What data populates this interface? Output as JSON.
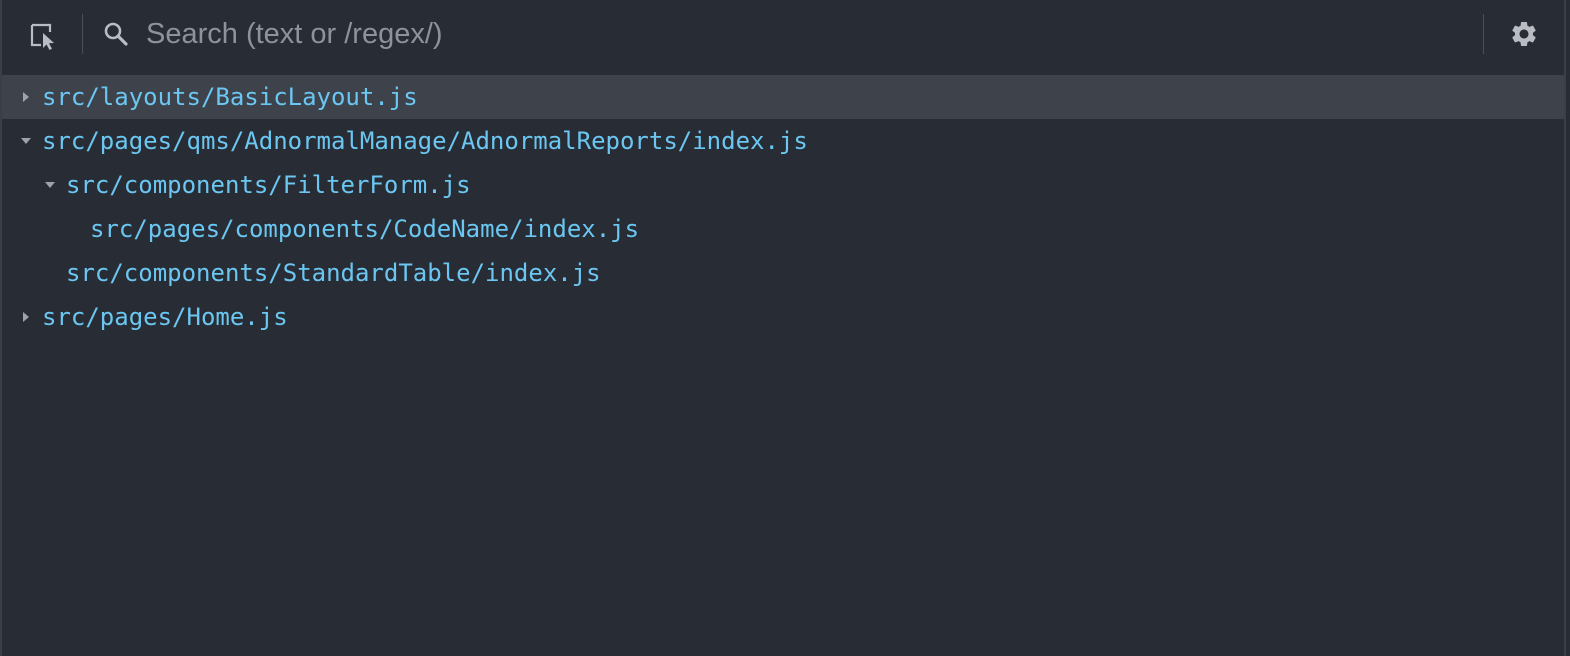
{
  "toolbar": {
    "inspect_icon": "inspect-element-icon",
    "search_icon": "search-icon",
    "search_placeholder": "Search (text or /regex/)",
    "search_value": "",
    "settings_icon": "gear-icon"
  },
  "colors": {
    "background": "#282c34",
    "selected_row": "#3d424b",
    "file_text": "#6bc7f2",
    "icon": "#b9bcc2",
    "placeholder": "#8d929b"
  },
  "tree": [
    {
      "label": "src/layouts/BasicLayout.js",
      "depth": 0,
      "state": "collapsed",
      "selected": true
    },
    {
      "label": "src/pages/qms/AdnormalManage/AdnormalReports/index.js",
      "depth": 0,
      "state": "expanded",
      "selected": false
    },
    {
      "label": "src/components/FilterForm.js",
      "depth": 1,
      "state": "expanded",
      "selected": false
    },
    {
      "label": "src/pages/components/CodeName/index.js",
      "depth": 2,
      "state": "leaf",
      "selected": false
    },
    {
      "label": "src/components/StandardTable/index.js",
      "depth": 1,
      "state": "leaf",
      "selected": false
    },
    {
      "label": "src/pages/Home.js",
      "depth": 0,
      "state": "collapsed",
      "selected": false
    }
  ]
}
